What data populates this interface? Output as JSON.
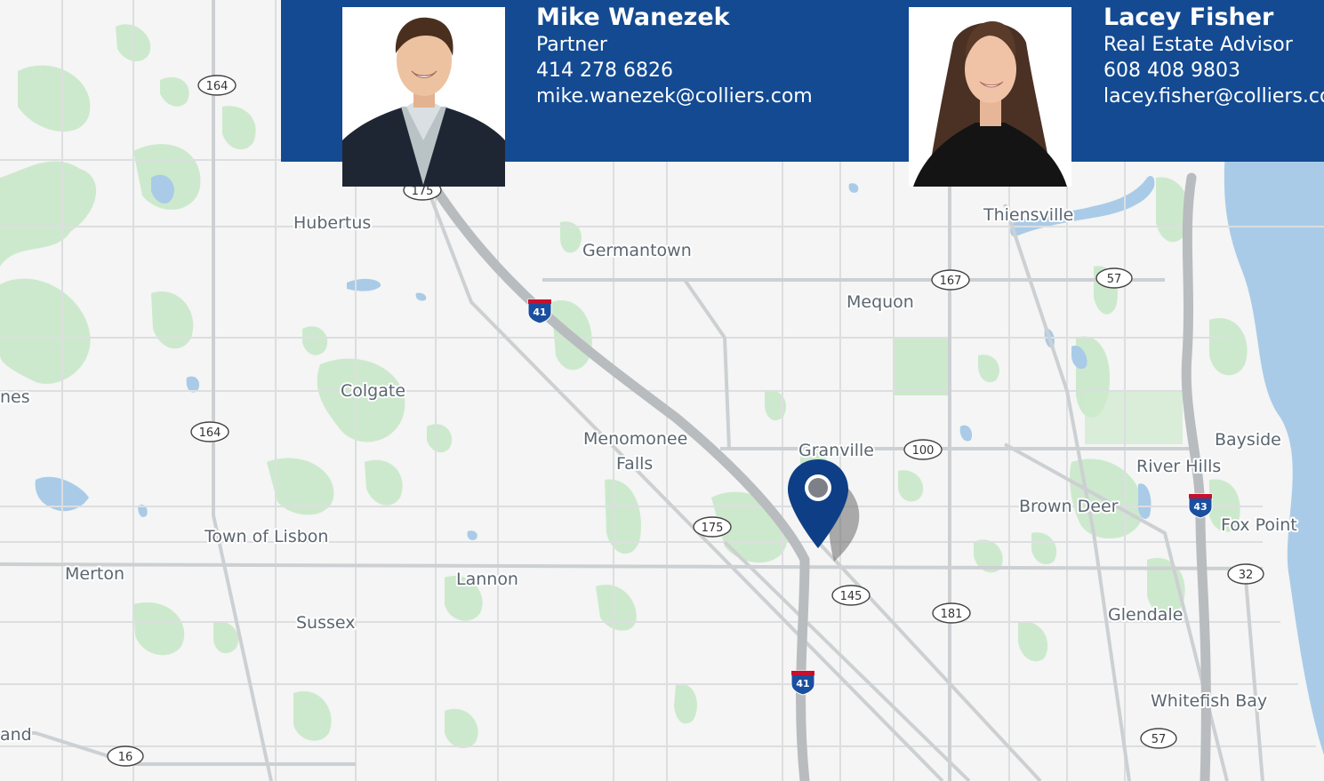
{
  "contacts": [
    {
      "name": "Mike Wanezek",
      "title": "Partner",
      "phone": "414 278 6826",
      "email": "mike.wanezek@colliers.com"
    },
    {
      "name": "Lacey Fisher",
      "title": "Real Estate Advisor",
      "phone": "608 408 9803",
      "email": "lacey.fisher@colliers.com"
    }
  ],
  "map": {
    "places": {
      "hubertus": "Hubertus",
      "germantown": "Germantown",
      "thiensville": "Thiensville",
      "mequon": "Mequon",
      "colgate": "Colgate",
      "menomonee_1": "Menomonee",
      "menomonee_2": "Falls",
      "granville": "Granville",
      "bayside": "Bayside",
      "river_hills": "River Hills",
      "brown_deer": "Brown Deer",
      "fox_point": "Fox Point",
      "town_of_lisbon": "Town of Lisbon",
      "merton": "Merton",
      "lannon": "Lannon",
      "sussex": "Sussex",
      "glendale": "Glendale",
      "whitefish_bay": "Whitefish Bay",
      "partial_left_1": "nes",
      "partial_left_2": "and"
    },
    "routes": {
      "r164a": "164",
      "r164b": "164",
      "r175a": "175",
      "r175b": "175",
      "r167": "167",
      "r57a": "57",
      "r57b": "57",
      "r100": "100",
      "r145": "145",
      "r181": "181",
      "r32": "32",
      "r16": "16"
    },
    "interstates": {
      "i41a": "41",
      "i41b": "41",
      "i43": "43"
    },
    "marker_icon": "location-pin-icon"
  },
  "colors": {
    "band": "#134a92",
    "park": "#cde9cd",
    "water": "#a9cbe8",
    "road": "#d9dbdd",
    "highway": "#b9bcbf",
    "pin": "#0e3f86"
  }
}
